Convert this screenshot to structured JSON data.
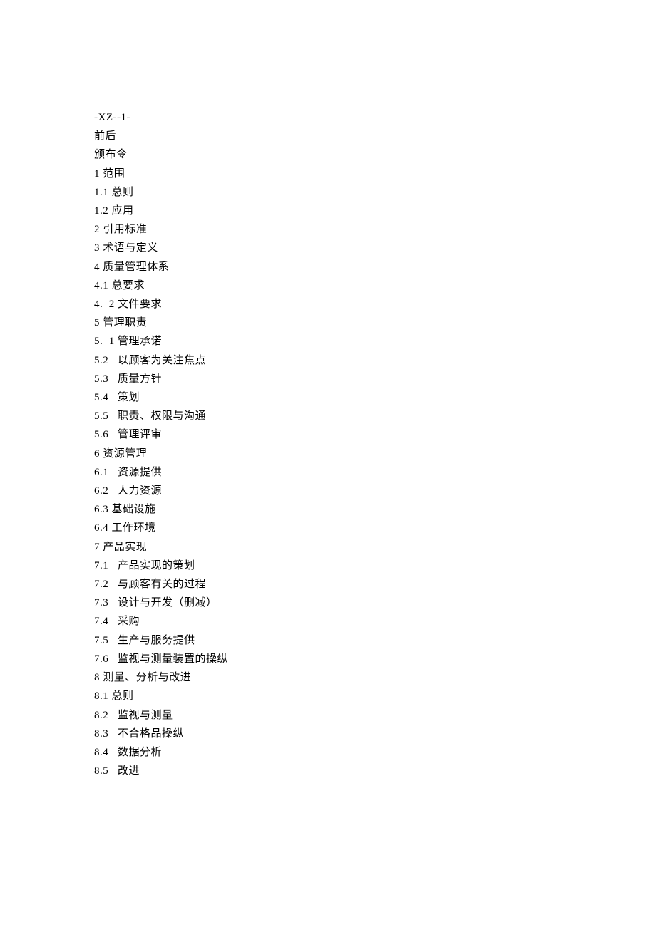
{
  "toc": {
    "lines": [
      "-XZ--1-",
      "前后",
      "颁布令",
      "1 范围",
      "1.1 总则",
      "1.2 应用",
      "2 引用标准",
      "3 术语与定义",
      "4 质量管理体系",
      "4.1 总要求",
      "4.  2 文件要求",
      "5 管理职责",
      "5.  1 管理承诺",
      "5.2   以顾客为关注焦点",
      "5.3   质量方针",
      "5.4   策划",
      "5.5   职责、权限与沟通",
      "5.6   管理评审",
      "6 资源管理",
      "6.1   资源提供",
      "6.2   人力资源",
      "6.3 基础设施",
      "6.4 工作环境",
      "7 产品实现",
      "7.1   产品实现的策划",
      "7.2   与顾客有关的过程",
      "7.3   设计与开发（删减）",
      "7.4   采购",
      "7.5   生产与服务提供",
      "7.6   监视与测量装置的操纵",
      "8 测量、分析与改进",
      "8.1 总则",
      "8.2   监视与测量",
      "8.3   不合格品操纵",
      "8.4   数据分析",
      "8.5   改进"
    ]
  }
}
